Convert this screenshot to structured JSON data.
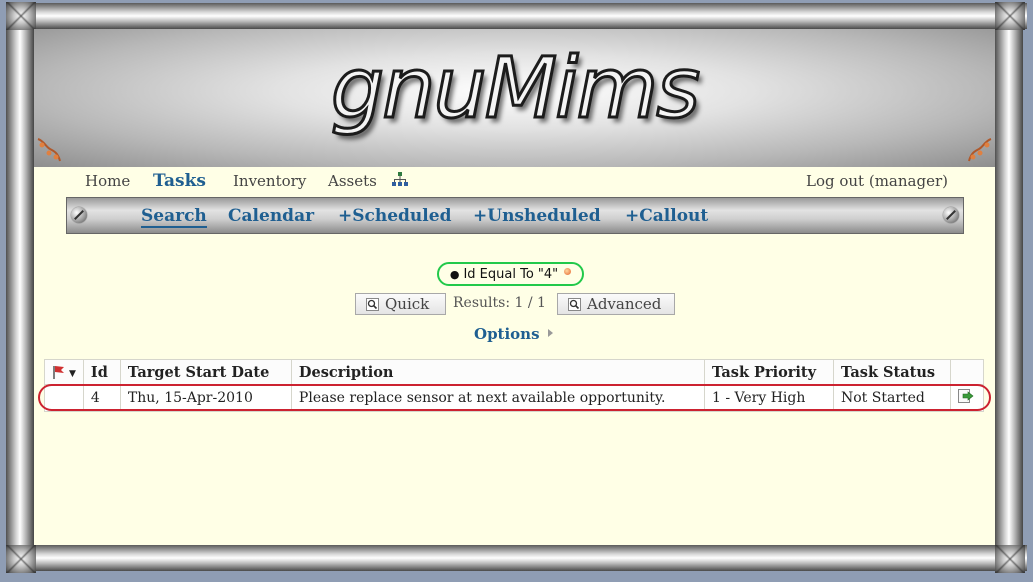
{
  "app": {
    "logo_text": "gnuMims"
  },
  "topnav": {
    "home": "Home",
    "tasks": "Tasks",
    "inventory": "Inventory",
    "assets": "Assets",
    "sitemap_icon": "sitemap-icon",
    "logout": "Log out (manager)"
  },
  "subnav": {
    "search": "Search",
    "calendar": "Calendar",
    "scheduled": "+Scheduled",
    "unscheduled": "+Unsheduled",
    "callout": "+Callout"
  },
  "filter": {
    "text": "Id Equal To \"4\"",
    "outline_color": "#22c94a"
  },
  "controls": {
    "quick": "Quick",
    "results": "Results: 1 / 1",
    "advanced": "Advanced",
    "options": "Options"
  },
  "table": {
    "headers": [
      "",
      "Id",
      "Target Start Date",
      "Description",
      "Task Priority",
      "Task Status",
      ""
    ],
    "rows": [
      {
        "id": "4",
        "target_start_date": "Thu, 15-Apr-2010",
        "description": "Please replace sensor at next available opportunity.",
        "priority": "1 - Very High",
        "status": "Not Started"
      }
    ],
    "highlight_color": "#cc2230"
  },
  "colors": {
    "link": "#1f5f91",
    "page_bg": "#ffffe6"
  }
}
